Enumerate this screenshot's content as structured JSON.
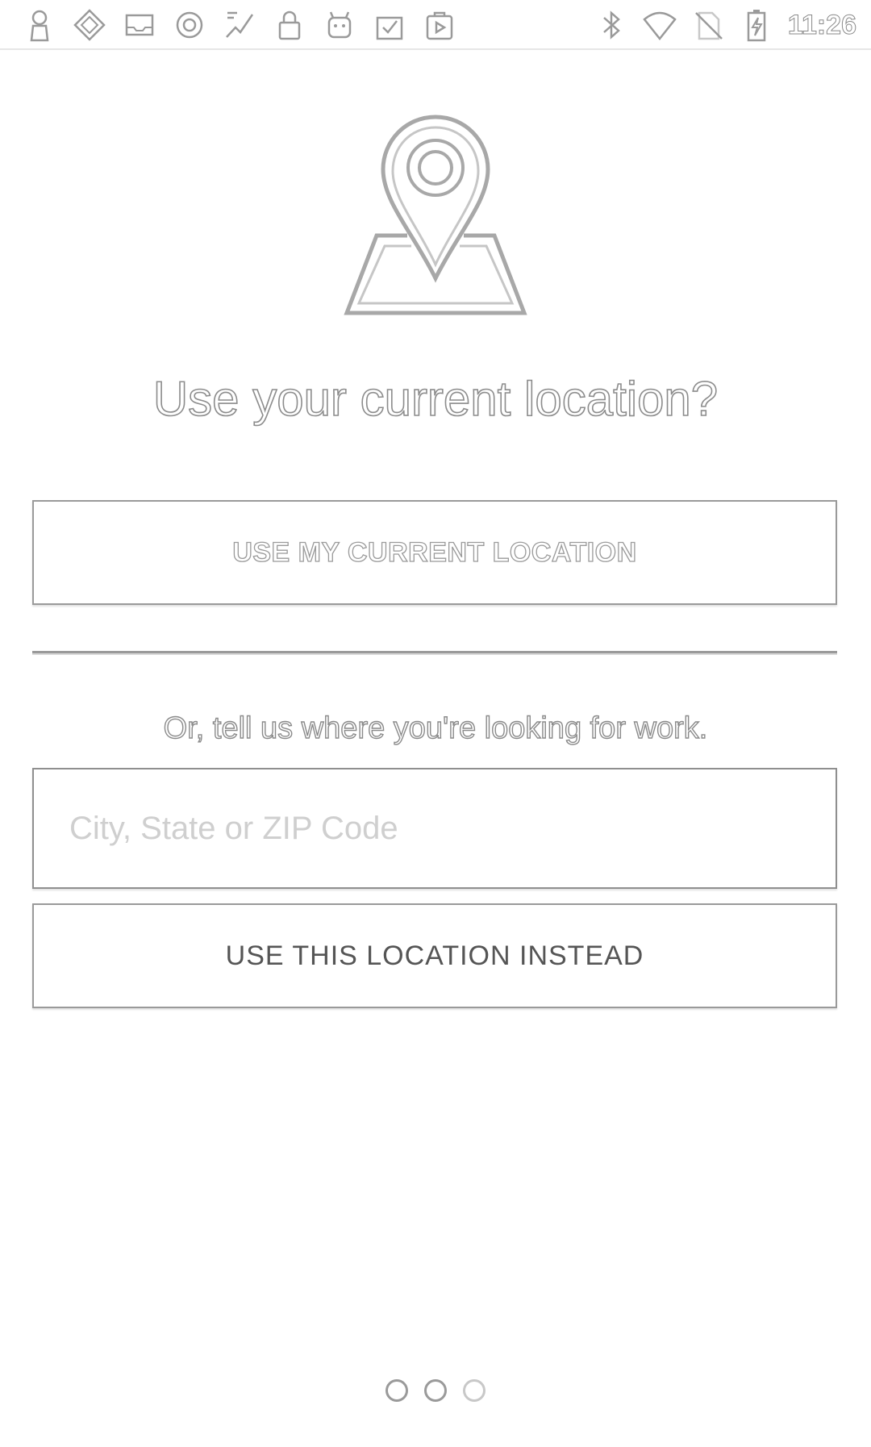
{
  "status_bar": {
    "time": "11:26",
    "left_icons": [
      "person-icon",
      "diamond-icon",
      "inbox-icon",
      "circle-o-icon",
      "map-edit-icon",
      "lock-icon",
      "android-icon",
      "clipboard-check-icon",
      "play-store-icon"
    ],
    "right_icons": [
      "bluetooth-icon",
      "wifi-icon",
      "no-sim-icon",
      "battery-charging-icon"
    ]
  },
  "main": {
    "hero_icon": "location-pin-map-icon",
    "headline": "Use your current location?",
    "use_current_label": "USE MY CURRENT LOCATION",
    "or_text": "Or, tell us where you're looking for work.",
    "location_input": {
      "value": "",
      "placeholder": "City, State or ZIP Code"
    },
    "use_instead_label": "USE THIS LOCATION INSTEAD"
  },
  "pager": {
    "pages": 3,
    "active_index": 1
  },
  "colors": {
    "outline": "#9a9a9a",
    "background": "#ffffff",
    "placeholder": "#cfcfcf"
  }
}
